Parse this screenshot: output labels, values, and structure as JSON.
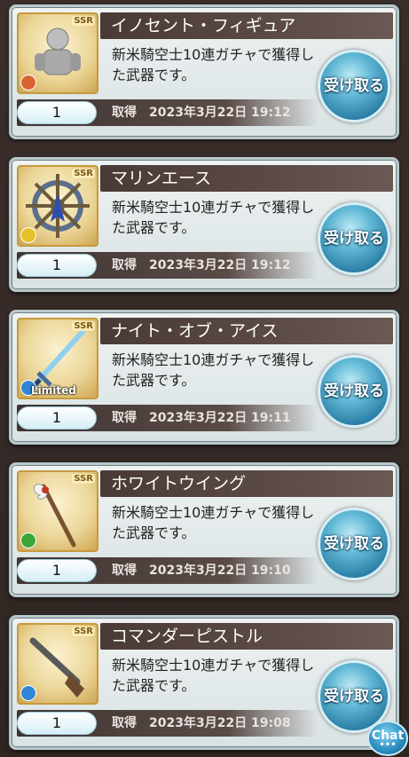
{
  "items": [
    {
      "name": "イノセント・フィギュア",
      "desc": "新米騎空士10連ガチャで獲得した武器です。",
      "qty": "1",
      "acq": "取得",
      "date": "2023年3月22日 19:12",
      "button": "受け取る",
      "element": "fire",
      "element_color": "#d9642e",
      "rarity": "SSR",
      "limited": ""
    },
    {
      "name": "マリンエース",
      "desc": "新米騎空士10連ガチャで獲得した武器です。",
      "qty": "1",
      "acq": "取得",
      "date": "2023年3月22日 19:12",
      "button": "受け取る",
      "element": "light",
      "element_color": "#e6c22a",
      "rarity": "SSR",
      "limited": ""
    },
    {
      "name": "ナイト・オブ・アイス",
      "desc": "新米騎空士10連ガチャで獲得した武器です。",
      "qty": "1",
      "acq": "取得",
      "date": "2023年3月22日 19:11",
      "button": "受け取る",
      "element": "water",
      "element_color": "#2f86d6",
      "rarity": "SSR",
      "limited": "Limited"
    },
    {
      "name": "ホワイトウイング",
      "desc": "新米騎空士10連ガチャで獲得した武器です。",
      "qty": "1",
      "acq": "取得",
      "date": "2023年3月22日 19:10",
      "button": "受け取る",
      "element": "wind",
      "element_color": "#3aa63a",
      "rarity": "SSR",
      "limited": ""
    },
    {
      "name": "コマンダーピストル",
      "desc": "新米騎空士10連ガチャで獲得した武器です。",
      "qty": "1",
      "acq": "取得",
      "date": "2023年3月22日 19:08",
      "button": "受け取る",
      "element": "water",
      "element_color": "#2f86d6",
      "rarity": "SSR",
      "limited": ""
    }
  ],
  "chat": {
    "label": "Chat",
    "dots": "•••"
  }
}
